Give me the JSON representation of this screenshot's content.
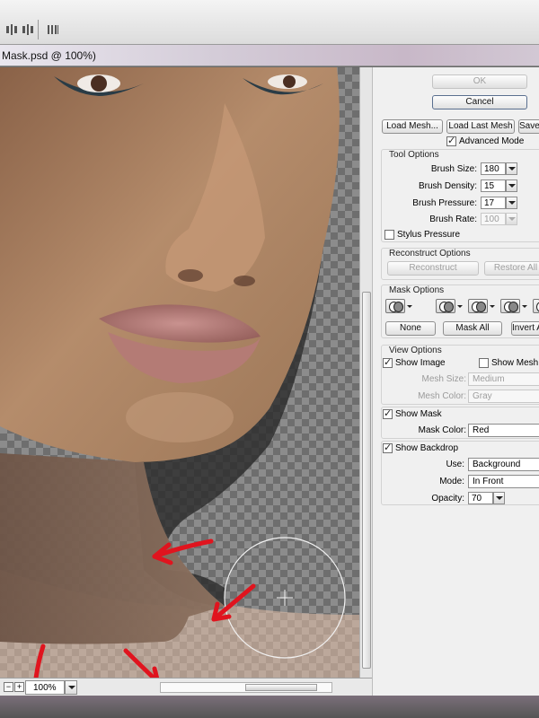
{
  "window": {
    "title": "Mask.psd @ 100%)"
  },
  "toolbar": {
    "icons": [
      "align-left-icon",
      "align-center-icon",
      "distribute-icon"
    ]
  },
  "status": {
    "zoom": "100%"
  },
  "panel": {
    "ok_label": "OK",
    "cancel_label": "Cancel",
    "load_mesh_label": "Load Mesh...",
    "load_last_mesh_label": "Load Last Mesh",
    "save_mesh_label": "Save Mesh...",
    "advanced_mode_label": "Advanced Mode",
    "tool_options": {
      "title": "Tool Options",
      "brush_size_label": "Brush Size:",
      "brush_size_value": "180",
      "brush_density_label": "Brush Density:",
      "brush_density_value": "15",
      "brush_pressure_label": "Brush Pressure:",
      "brush_pressure_value": "17",
      "brush_rate_label": "Brush Rate:",
      "brush_rate_value": "100",
      "stylus_pressure_label": "Stylus Pressure"
    },
    "reconstruct_options": {
      "title": "Reconstruct Options",
      "reconstruct_label": "Reconstruct",
      "restore_all_label": "Restore All"
    },
    "mask_options": {
      "title": "Mask Options",
      "none_label": "None",
      "mask_all_label": "Mask All",
      "invert_all_label": "Invert All"
    },
    "view_options": {
      "title": "View Options",
      "show_image_label": "Show Image",
      "show_mesh_label": "Show Mesh",
      "mesh_size_label": "Mesh Size:",
      "mesh_size_value": "Medium",
      "mesh_color_label": "Mesh Color:",
      "mesh_color_value": "Gray"
    },
    "mask_view": {
      "show_mask_label": "Show Mask",
      "mask_color_label": "Mask Color:",
      "mask_color_value": "Red"
    },
    "backdrop": {
      "show_backdrop_label": "Show Backdrop",
      "use_label": "Use:",
      "use_value": "Background",
      "mode_label": "Mode:",
      "mode_value": "In Front",
      "opacity_label": "Opacity:",
      "opacity_value": "70"
    }
  },
  "colors": {
    "annotation_arrow": "#e0141e",
    "skin": "#b08868",
    "panel_bg": "#f0f0f0"
  }
}
